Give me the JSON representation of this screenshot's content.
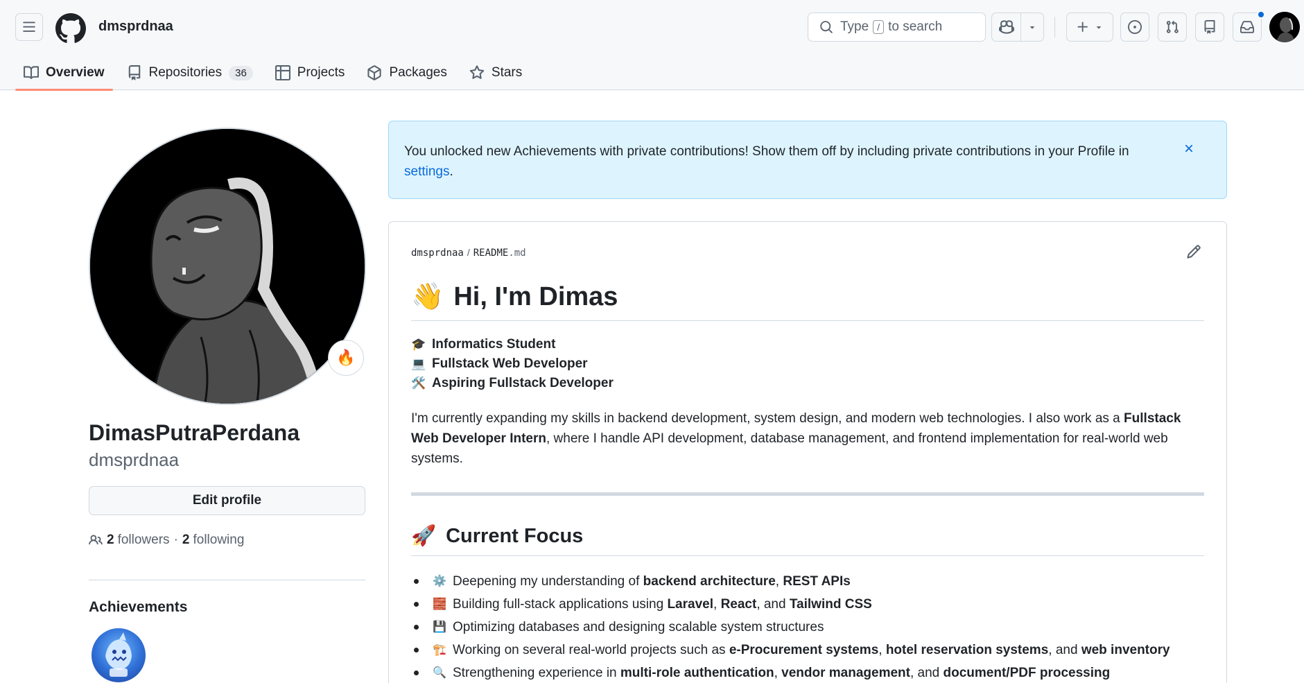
{
  "header": {
    "username": "dmsprdnaa",
    "search": {
      "before_key": "Type",
      "key": "/",
      "after_key": "to search"
    }
  },
  "tabs": [
    {
      "label": "Overview",
      "active": true
    },
    {
      "label": "Repositories",
      "count": "36"
    },
    {
      "label": "Projects"
    },
    {
      "label": "Packages"
    },
    {
      "label": "Stars"
    }
  ],
  "profile": {
    "status_emoji": "🔥",
    "full_name": "DimasPutraPerdana",
    "login": "dmsprdnaa",
    "edit_label": "Edit profile",
    "followers_count": "2",
    "followers_label": "followers",
    "dot": "·",
    "following_count": "2",
    "following_label": "following",
    "achievements_title": "Achievements"
  },
  "flash": {
    "text": "You unlocked new Achievements with private contributions! Show them off by including private contributions in your Profile in",
    "link": "settings",
    "end": "."
  },
  "readme": {
    "owner": "dmsprdnaa",
    "separator": "/",
    "file_name": "README",
    "file_ext": ".md",
    "title_emoji": "👋",
    "title": "Hi, I'm Dimas",
    "roles": [
      {
        "icon": "🎓",
        "label": "Informatics Student"
      },
      {
        "icon": "💻",
        "label": "Fullstack Web Developer"
      },
      {
        "icon": "🛠️",
        "label": "Aspiring Fullstack Developer"
      }
    ],
    "para": {
      "p1": "I'm currently expanding my skills in backend development, system design, and modern web technologies. I also work as a ",
      "b1": "Fullstack Web Developer Intern",
      "p2": ", where I handle API development, database management, and frontend implementation for real-world web systems."
    },
    "focus_emoji": "🚀",
    "focus_title": "Current Focus",
    "focus": [
      {
        "icon": "⚙️",
        "t1": "Deepening my understanding of ",
        "b1": "backend architecture",
        "t2": ", ",
        "b2": "REST APIs",
        "t3": "",
        "b3": ""
      },
      {
        "icon": "🧱",
        "t1": "Building full-stack applications using ",
        "b1": "Laravel",
        "t2": ", ",
        "b2": "React",
        "t3": ", and ",
        "b3": "Tailwind CSS"
      },
      {
        "icon": "💾",
        "t1": "Optimizing databases and designing scalable system structures",
        "b1": "",
        "t2": "",
        "b2": "",
        "t3": "",
        "b3": ""
      },
      {
        "icon": "🏗️",
        "t1": "Working on several real-world projects such as ",
        "b1": "e-Procurement systems",
        "t2": ", ",
        "b2": "hotel reservation systems",
        "t3": ", and ",
        "b3": "web inventory"
      },
      {
        "icon": "🔍",
        "t1": "Strengthening experience in ",
        "b1": "multi-role authentication",
        "t2": ", ",
        "b2": "vendor management",
        "t3": ", and ",
        "b3": "document/PDF processing"
      }
    ]
  }
}
